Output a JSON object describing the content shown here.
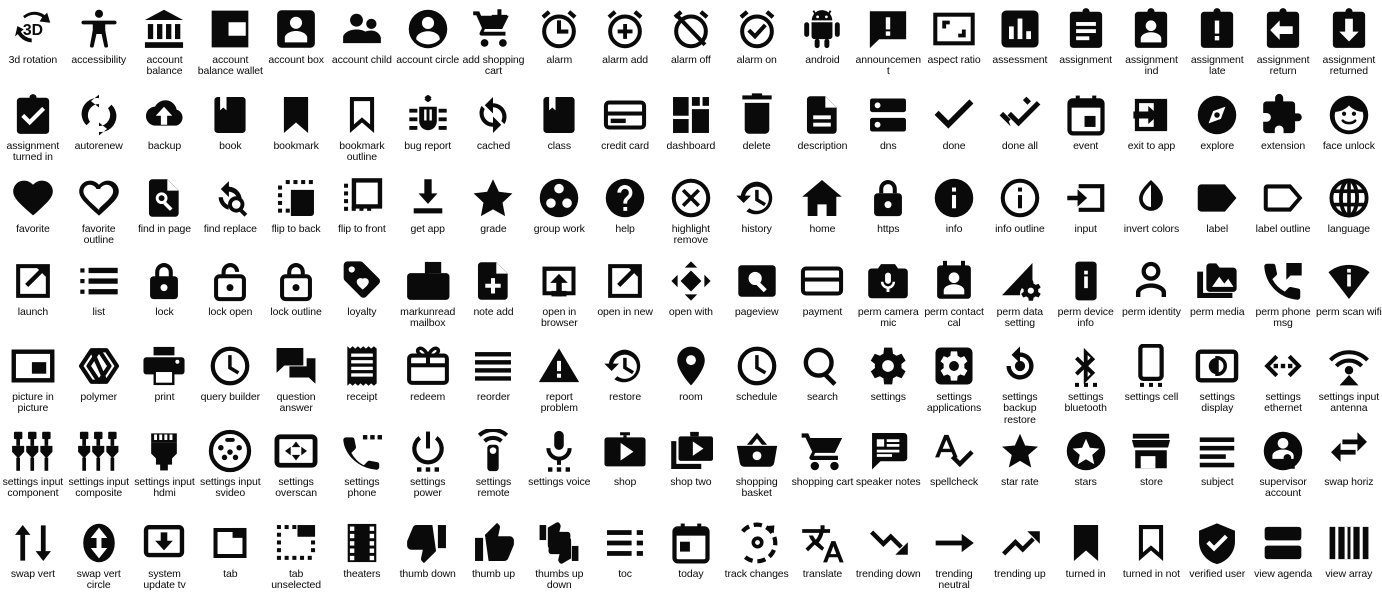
{
  "page": {
    "title": "Material icon set sheet",
    "columns": 21,
    "rows": 7,
    "icon_color": "#0a0a0a",
    "background_color": "#ffffff",
    "total_icons": 147
  },
  "icons": [
    {
      "label": "3d rotation",
      "glyph": "3d-rotation-icon"
    },
    {
      "label": "accessibility",
      "glyph": "accessibility-icon"
    },
    {
      "label": "account balance",
      "glyph": "account-balance-icon"
    },
    {
      "label": "account balance wallet",
      "glyph": "account-balance-wallet-icon"
    },
    {
      "label": "account box",
      "glyph": "account-box-icon"
    },
    {
      "label": "account child",
      "glyph": "account-child-icon"
    },
    {
      "label": "account circle",
      "glyph": "account-circle-icon"
    },
    {
      "label": "add shopping cart",
      "glyph": "add-shopping-cart-icon"
    },
    {
      "label": "alarm",
      "glyph": "alarm-icon"
    },
    {
      "label": "alarm add",
      "glyph": "alarm-add-icon"
    },
    {
      "label": "alarm off",
      "glyph": "alarm-off-icon"
    },
    {
      "label": "alarm on",
      "glyph": "alarm-on-icon"
    },
    {
      "label": "android",
      "glyph": "android-icon"
    },
    {
      "label": "announcement",
      "glyph": "announcement-icon"
    },
    {
      "label": "aspect ratio",
      "glyph": "aspect-ratio-icon"
    },
    {
      "label": "assessment",
      "glyph": "assessment-icon"
    },
    {
      "label": "assignment",
      "glyph": "assignment-icon"
    },
    {
      "label": "assignment ind",
      "glyph": "assignment-ind-icon"
    },
    {
      "label": "assignment late",
      "glyph": "assignment-late-icon"
    },
    {
      "label": "assignment return",
      "glyph": "assignment-return-icon"
    },
    {
      "label": "assignment returned",
      "glyph": "assignment-returned-icon"
    },
    {
      "label": "assignment turned in",
      "glyph": "assignment-turned-in-icon"
    },
    {
      "label": "autorenew",
      "glyph": "autorenew-icon"
    },
    {
      "label": "backup",
      "glyph": "backup-icon"
    },
    {
      "label": "book",
      "glyph": "book-icon"
    },
    {
      "label": "bookmark",
      "glyph": "bookmark-icon"
    },
    {
      "label": "bookmark outline",
      "glyph": "bookmark-outline-icon"
    },
    {
      "label": "bug report",
      "glyph": "bug-report-icon"
    },
    {
      "label": "cached",
      "glyph": "cached-icon"
    },
    {
      "label": "class",
      "glyph": "class-icon"
    },
    {
      "label": "credit card",
      "glyph": "credit-card-icon"
    },
    {
      "label": "dashboard",
      "glyph": "dashboard-icon"
    },
    {
      "label": "delete",
      "glyph": "delete-icon"
    },
    {
      "label": "description",
      "glyph": "description-icon"
    },
    {
      "label": "dns",
      "glyph": "dns-icon"
    },
    {
      "label": "done",
      "glyph": "done-icon"
    },
    {
      "label": "done all",
      "glyph": "done-all-icon"
    },
    {
      "label": "event",
      "glyph": "event-icon"
    },
    {
      "label": "exit to app",
      "glyph": "exit-to-app-icon"
    },
    {
      "label": "explore",
      "glyph": "explore-icon"
    },
    {
      "label": "extension",
      "glyph": "extension-icon"
    },
    {
      "label": "face unlock",
      "glyph": "face-unlock-icon"
    },
    {
      "label": "favorite",
      "glyph": "favorite-icon"
    },
    {
      "label": "favorite outline",
      "glyph": "favorite-outline-icon"
    },
    {
      "label": "find in page",
      "glyph": "find-in-page-icon"
    },
    {
      "label": "find replace",
      "glyph": "find-replace-icon"
    },
    {
      "label": "flip to back",
      "glyph": "flip-to-back-icon"
    },
    {
      "label": "flip to front",
      "glyph": "flip-to-front-icon"
    },
    {
      "label": "get app",
      "glyph": "get-app-icon"
    },
    {
      "label": "grade",
      "glyph": "grade-icon"
    },
    {
      "label": "group work",
      "glyph": "group-work-icon"
    },
    {
      "label": "help",
      "glyph": "help-icon"
    },
    {
      "label": "highlight remove",
      "glyph": "highlight-remove-icon"
    },
    {
      "label": "history",
      "glyph": "history-icon"
    },
    {
      "label": "home",
      "glyph": "home-icon"
    },
    {
      "label": "https",
      "glyph": "https-icon"
    },
    {
      "label": "info",
      "glyph": "info-icon"
    },
    {
      "label": "info outline",
      "glyph": "info-outline-icon"
    },
    {
      "label": "input",
      "glyph": "input-icon"
    },
    {
      "label": "invert colors",
      "glyph": "invert-colors-icon"
    },
    {
      "label": "label",
      "glyph": "label-icon"
    },
    {
      "label": "label outline",
      "glyph": "label-outline-icon"
    },
    {
      "label": "language",
      "glyph": "language-icon"
    },
    {
      "label": "launch",
      "glyph": "launch-icon"
    },
    {
      "label": "list",
      "glyph": "list-icon"
    },
    {
      "label": "lock",
      "glyph": "lock-icon"
    },
    {
      "label": "lock open",
      "glyph": "lock-open-icon"
    },
    {
      "label": "lock outline",
      "glyph": "lock-outline-icon"
    },
    {
      "label": "loyalty",
      "glyph": "loyalty-icon"
    },
    {
      "label": "markunread mailbox",
      "glyph": "markunread-mailbox-icon"
    },
    {
      "label": "note add",
      "glyph": "note-add-icon"
    },
    {
      "label": "open in browser",
      "glyph": "open-in-browser-icon"
    },
    {
      "label": "open in new",
      "glyph": "open-in-new-icon"
    },
    {
      "label": "open with",
      "glyph": "open-with-icon"
    },
    {
      "label": "pageview",
      "glyph": "pageview-icon"
    },
    {
      "label": "payment",
      "glyph": "payment-icon"
    },
    {
      "label": "perm camera mic",
      "glyph": "perm-camera-mic-icon"
    },
    {
      "label": "perm contact cal",
      "glyph": "perm-contact-cal-icon"
    },
    {
      "label": "perm data setting",
      "glyph": "perm-data-setting-icon"
    },
    {
      "label": "perm device info",
      "glyph": "perm-device-info-icon"
    },
    {
      "label": "perm identity",
      "glyph": "perm-identity-icon"
    },
    {
      "label": "perm media",
      "glyph": "perm-media-icon"
    },
    {
      "label": "perm phone msg",
      "glyph": "perm-phone-msg-icon"
    },
    {
      "label": "perm scan wifi",
      "glyph": "perm-scan-wifi-icon"
    },
    {
      "label": "picture in picture",
      "glyph": "picture-in-picture-icon"
    },
    {
      "label": "polymer",
      "glyph": "polymer-icon"
    },
    {
      "label": "print",
      "glyph": "print-icon"
    },
    {
      "label": "query builder",
      "glyph": "query-builder-icon"
    },
    {
      "label": "question answer",
      "glyph": "question-answer-icon"
    },
    {
      "label": "receipt",
      "glyph": "receipt-icon"
    },
    {
      "label": "redeem",
      "glyph": "redeem-icon"
    },
    {
      "label": "reorder",
      "glyph": "reorder-icon"
    },
    {
      "label": "report problem",
      "glyph": "report-problem-icon"
    },
    {
      "label": "restore",
      "glyph": "restore-icon"
    },
    {
      "label": "room",
      "glyph": "room-icon"
    },
    {
      "label": "schedule",
      "glyph": "schedule-icon"
    },
    {
      "label": "search",
      "glyph": "search-icon"
    },
    {
      "label": "settings",
      "glyph": "settings-icon"
    },
    {
      "label": "settings applications",
      "glyph": "settings-applications-icon"
    },
    {
      "label": "settings backup restore",
      "glyph": "settings-backup-restore-icon"
    },
    {
      "label": "settings bluetooth",
      "glyph": "settings-bluetooth-icon"
    },
    {
      "label": "settings cell",
      "glyph": "settings-cell-icon"
    },
    {
      "label": "settings display",
      "glyph": "settings-display-icon"
    },
    {
      "label": "settings ethernet",
      "glyph": "settings-ethernet-icon"
    },
    {
      "label": "settings input antenna",
      "glyph": "settings-input-antenna-icon"
    },
    {
      "label": "settings input component",
      "glyph": "settings-input-component-icon"
    },
    {
      "label": "settings input composite",
      "glyph": "settings-input-composite-icon"
    },
    {
      "label": "settings input hdmi",
      "glyph": "settings-input-hdmi-icon"
    },
    {
      "label": "settings input svideo",
      "glyph": "settings-input-svideo-icon"
    },
    {
      "label": "settings overscan",
      "glyph": "settings-overscan-icon"
    },
    {
      "label": "settings phone",
      "glyph": "settings-phone-icon"
    },
    {
      "label": "settings power",
      "glyph": "settings-power-icon"
    },
    {
      "label": "settings remote",
      "glyph": "settings-remote-icon"
    },
    {
      "label": "settings voice",
      "glyph": "settings-voice-icon"
    },
    {
      "label": "shop",
      "glyph": "shop-icon"
    },
    {
      "label": "shop two",
      "glyph": "shop-two-icon"
    },
    {
      "label": "shopping basket",
      "glyph": "shopping-basket-icon"
    },
    {
      "label": "shopping cart",
      "glyph": "shopping-cart-icon"
    },
    {
      "label": "speaker notes",
      "glyph": "speaker-notes-icon"
    },
    {
      "label": "spellcheck",
      "glyph": "spellcheck-icon"
    },
    {
      "label": "star rate",
      "glyph": "star-rate-icon"
    },
    {
      "label": "stars",
      "glyph": "stars-icon"
    },
    {
      "label": "store",
      "glyph": "store-icon"
    },
    {
      "label": "subject",
      "glyph": "subject-icon"
    },
    {
      "label": "supervisor account",
      "glyph": "supervisor-account-icon"
    },
    {
      "label": "swap horiz",
      "glyph": "swap-horiz-icon"
    },
    {
      "label": "swap vert",
      "glyph": "swap-vert-icon"
    },
    {
      "label": "swap vert circle",
      "glyph": "swap-vert-circle-icon"
    },
    {
      "label": "system update tv",
      "glyph": "system-update-tv-icon"
    },
    {
      "label": "tab",
      "glyph": "tab-icon"
    },
    {
      "label": "tab unselected",
      "glyph": "tab-unselected-icon"
    },
    {
      "label": "theaters",
      "glyph": "theaters-icon"
    },
    {
      "label": "thumb down",
      "glyph": "thumb-down-icon"
    },
    {
      "label": "thumb up",
      "glyph": "thumb-up-icon"
    },
    {
      "label": "thumbs up down",
      "glyph": "thumbs-up-down-icon"
    },
    {
      "label": "toc",
      "glyph": "toc-icon"
    },
    {
      "label": "today",
      "glyph": "today-icon"
    },
    {
      "label": "track changes",
      "glyph": "track-changes-icon"
    },
    {
      "label": "translate",
      "glyph": "translate-icon"
    },
    {
      "label": "trending down",
      "glyph": "trending-down-icon"
    },
    {
      "label": "trending neutral",
      "glyph": "trending-neutral-icon"
    },
    {
      "label": "trending up",
      "glyph": "trending-up-icon"
    },
    {
      "label": "turned in",
      "glyph": "turned-in-icon"
    },
    {
      "label": "turned in not",
      "glyph": "turned-in-not-icon"
    },
    {
      "label": "verified user",
      "glyph": "verified-user-icon"
    },
    {
      "label": "view agenda",
      "glyph": "view-agenda-icon"
    },
    {
      "label": "view array",
      "glyph": "view-array-icon"
    }
  ]
}
